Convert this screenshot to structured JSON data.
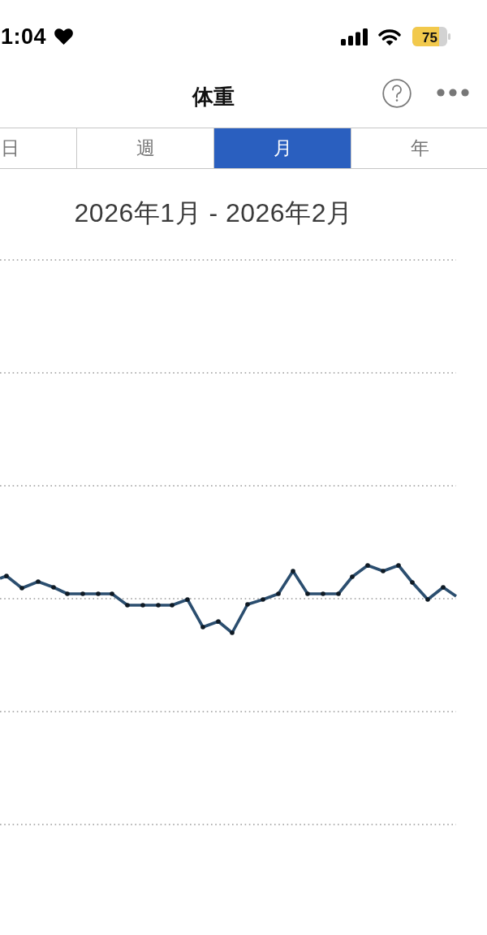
{
  "status_bar": {
    "time": "1:04",
    "battery": "75"
  },
  "header": {
    "title": "体重"
  },
  "tabs": [
    {
      "label": "日",
      "selected": false
    },
    {
      "label": "週",
      "selected": false
    },
    {
      "label": "月",
      "selected": true
    },
    {
      "label": "年",
      "selected": false
    }
  ],
  "chart": {
    "title": "2026年1月 - 2026年2月"
  }
}
